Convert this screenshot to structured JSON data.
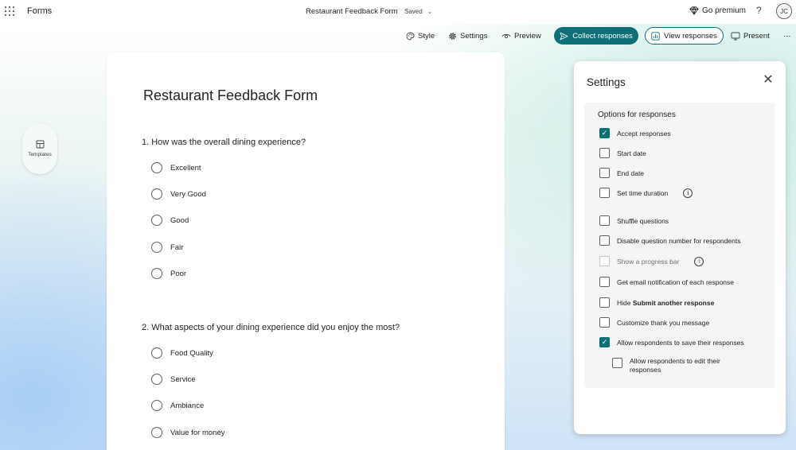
{
  "app": {
    "name": "Forms"
  },
  "document": {
    "title": "Restaurant Feedback Form",
    "status": "Saved"
  },
  "header": {
    "premium_label": "Go premium",
    "help_glyph": "?",
    "avatar_initials": "JC",
    "more_glyph": "···"
  },
  "toolbar": {
    "style_label": "Style",
    "settings_label": "Settings",
    "preview_label": "Preview",
    "collect_label": "Collect responses",
    "view_label": "View responses",
    "present_label": "Present"
  },
  "templates": {
    "label": "Templates"
  },
  "form": {
    "title": "Restaurant Feedback Form",
    "questions": [
      {
        "label": "1. How was the overall dining experience?",
        "options": [
          "Excellent",
          "Very Good",
          "Good",
          "Fair",
          "Poor"
        ]
      },
      {
        "label": "2. What aspects of your dining experience did you enjoy the most?",
        "options": [
          "Food Quality",
          "Service",
          "Ambiance",
          "Value for money"
        ]
      }
    ]
  },
  "settings": {
    "title": "Settings",
    "section_title": "Options for responses",
    "options": [
      {
        "label": "Accept responses",
        "checked": true
      },
      {
        "label": "Start date",
        "checked": false
      },
      {
        "label": "End date",
        "checked": false
      },
      {
        "label": "Set time duration",
        "checked": false
      },
      {
        "label": "Shuffle questions",
        "checked": false
      },
      {
        "label": "Disable question number for respondents",
        "checked": false
      },
      {
        "label": "Show a progress bar",
        "checked": false,
        "disabled": true
      },
      {
        "label": "Get email notification of each response",
        "checked": false
      },
      {
        "label_prefix": "Hide ",
        "label_bold": "Submit another response",
        "checked": false
      },
      {
        "label": "Customize thank you message",
        "checked": false
      },
      {
        "label": "Allow respondents to save their responses",
        "checked": true
      },
      {
        "label": "Allow respondents to edit their responses",
        "checked": false
      }
    ]
  },
  "colors": {
    "accent": "#0e7076",
    "panel_bg": "#f5f5f5"
  },
  "icons": {
    "waffle": "app-launcher-icon",
    "style": "palette-icon",
    "settings": "gear-icon",
    "preview": "eye-icon",
    "collect": "send-icon",
    "view": "chart-icon",
    "present": "monitor-icon",
    "premium": "diamond-icon",
    "templates": "template-icon",
    "close": "close-icon",
    "info": "info-icon"
  }
}
